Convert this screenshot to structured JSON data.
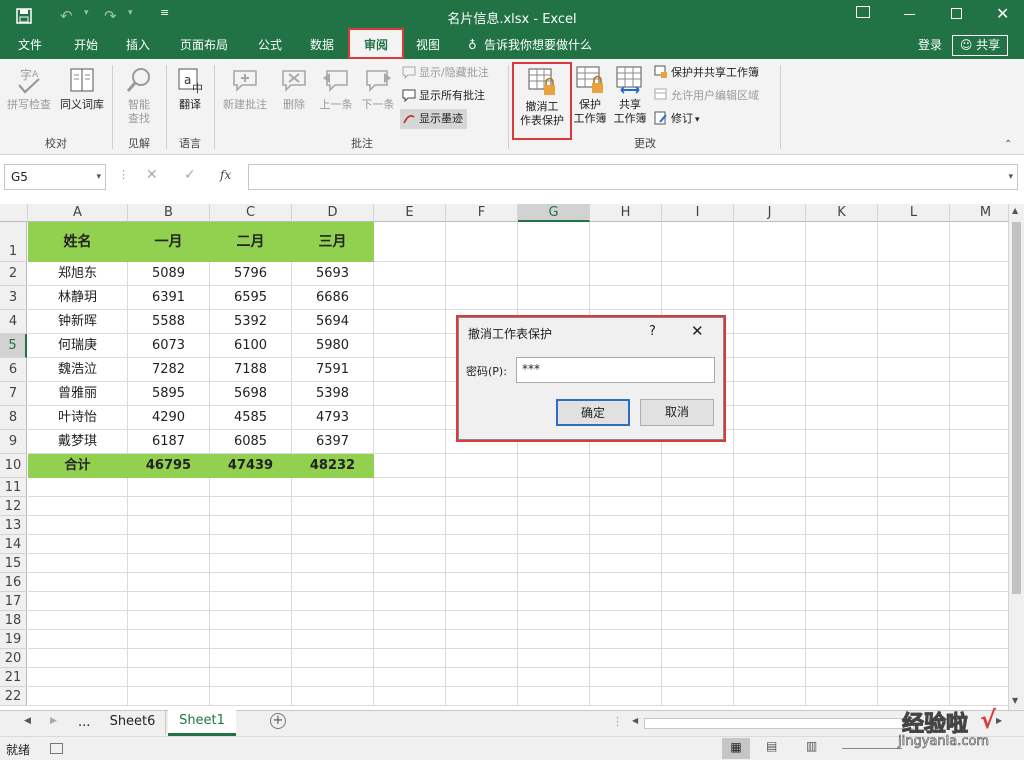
{
  "window": {
    "title": "名片信息.xlsx - Excel"
  },
  "tabs": [
    "文件",
    "开始",
    "插入",
    "页面布局",
    "公式",
    "数据",
    "审阅",
    "视图"
  ],
  "active_tab": "审阅",
  "tell_me": "告诉我你想要做什么",
  "account": {
    "login": "登录",
    "share": "共享"
  },
  "ribbon": {
    "spelling": "拼写检查",
    "thesaurus": "同义词库",
    "smart_lookup_1": "智能",
    "smart_lookup_2": "查找",
    "translate": "翻译",
    "new_comment": "新建批注",
    "delete": "删除",
    "previous": "上一条",
    "next": "下一条",
    "show_hide_comment": "显示/隐藏批注",
    "show_all_comments": "显示所有批注",
    "show_ink": "显示墨迹",
    "unprotect_1": "撤消工",
    "unprotect_2": "作表保护",
    "protect_wb_1": "保护",
    "protect_wb_2": "工作簿",
    "share_wb_1": "共享",
    "share_wb_2": "工作簿",
    "protect_share": "保护并共享工作簿",
    "allow_edit": "允许用户编辑区域",
    "track": "修订",
    "groups": {
      "proofing": "校对",
      "insights": "见解",
      "language": "语言",
      "comments": "批注",
      "changes": "更改"
    }
  },
  "formula_bar": {
    "name_box": "G5",
    "fx": "fx",
    "value": ""
  },
  "columns": [
    "A",
    "B",
    "C",
    "D",
    "E",
    "F",
    "G",
    "H",
    "I",
    "J",
    "K",
    "L",
    "M"
  ],
  "rows": [
    "1",
    "2",
    "3",
    "4",
    "5",
    "6",
    "7",
    "8",
    "9",
    "10",
    "11",
    "12",
    "13",
    "14",
    "15",
    "16",
    "17",
    "18",
    "19",
    "20",
    "21",
    "22"
  ],
  "table": {
    "header": [
      "姓名",
      "一月",
      "二月",
      "三月"
    ],
    "data": [
      [
        "郑旭东",
        "5089",
        "5796",
        "5693"
      ],
      [
        "林静玥",
        "6391",
        "6595",
        "6686"
      ],
      [
        "钟新晖",
        "5588",
        "5392",
        "5694"
      ],
      [
        "何瑞庚",
        "6073",
        "6100",
        "5980"
      ],
      [
        "魏浩泣",
        "7282",
        "7188",
        "7591"
      ],
      [
        "曾雅丽",
        "5895",
        "5698",
        "5398"
      ],
      [
        "叶诗怡",
        "4290",
        "4585",
        "4793"
      ],
      [
        "戴梦琪",
        "6187",
        "6085",
        "6397"
      ]
    ],
    "total": [
      "合计",
      "46795",
      "47439",
      "48232"
    ]
  },
  "sheets": {
    "ellipsis": "...",
    "names": [
      "Sheet6",
      "Sheet1"
    ],
    "active": "Sheet1"
  },
  "status": {
    "ready": "就绪"
  },
  "dialog": {
    "title": "撤消工作表保护",
    "help": "?",
    "password_label": "密码(P):",
    "password_value": "***",
    "ok": "确定",
    "cancel": "取消"
  },
  "watermark": {
    "text": "经验啦",
    "url": "jingyanla.com"
  },
  "colors": {
    "excel_green": "#217346",
    "header_fill": "#92d050",
    "highlight_red": "#d93a3a"
  }
}
